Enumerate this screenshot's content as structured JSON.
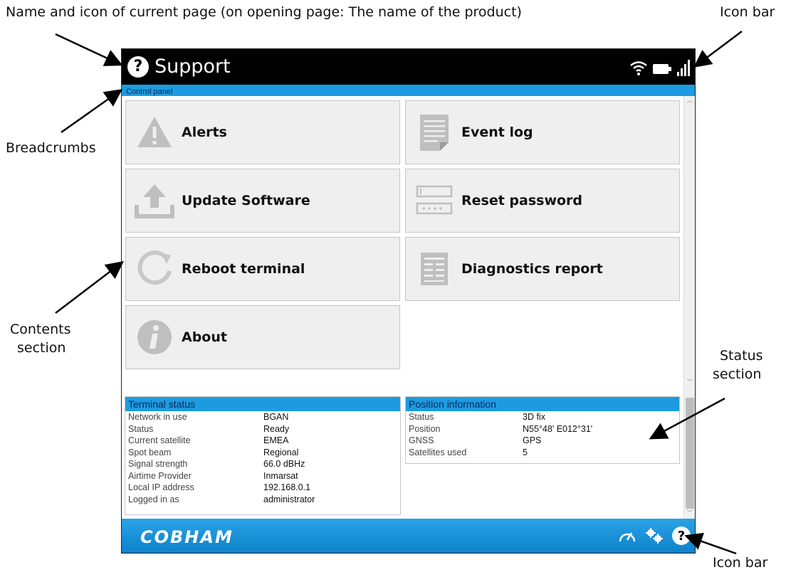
{
  "annotations": {
    "top_left": "Name and icon of current page (on opening page: The name of the product)",
    "top_right": "Icon bar",
    "breadcrumbs": "Breadcrumbs",
    "contents_line1": "Contents",
    "contents_line2": "section",
    "status_line1": "Status",
    "status_line2": "section",
    "bottom_right": "Icon bar"
  },
  "header": {
    "help_glyph": "?",
    "title": "Support"
  },
  "breadcrumb": "Control panel",
  "tiles": [
    {
      "label": "Alerts",
      "icon": "warning-icon"
    },
    {
      "label": "Event log",
      "icon": "document-icon"
    },
    {
      "label": "Update Software",
      "icon": "upload-icon"
    },
    {
      "label": "Reset password",
      "icon": "password-form-icon"
    },
    {
      "label": "Reboot terminal",
      "icon": "reboot-icon"
    },
    {
      "label": "Diagnostics report",
      "icon": "report-icon"
    },
    {
      "label": "About",
      "icon": "info-icon"
    }
  ],
  "terminal_status": {
    "title": "Terminal status",
    "rows": [
      {
        "k": "Network in use",
        "v": "BGAN"
      },
      {
        "k": "Status",
        "v": "Ready"
      },
      {
        "k": "Current satellite",
        "v": "EMEA"
      },
      {
        "k": "Spot beam",
        "v": "Regional"
      },
      {
        "k": "Signal strength",
        "v": "66.0 dBHz"
      },
      {
        "k": "Airtime Provider",
        "v": "Inmarsat"
      },
      {
        "k": "Local IP address",
        "v": "192.168.0.1"
      },
      {
        "k": "Logged in as",
        "v": "administrator"
      }
    ]
  },
  "position_info": {
    "title": "Position information",
    "rows": [
      {
        "k": "Status",
        "v": "3D fix"
      },
      {
        "k": "Position",
        "v": "N55°48' E012°31'"
      },
      {
        "k": "GNSS",
        "v": "GPS"
      },
      {
        "k": "Satellites used",
        "v": "5"
      }
    ]
  },
  "footer": {
    "brand": "COBHAM",
    "help_glyph": "?"
  },
  "colors": {
    "accent": "#1d9be0",
    "topbar": "#000000",
    "tile_bg": "#efefef"
  }
}
